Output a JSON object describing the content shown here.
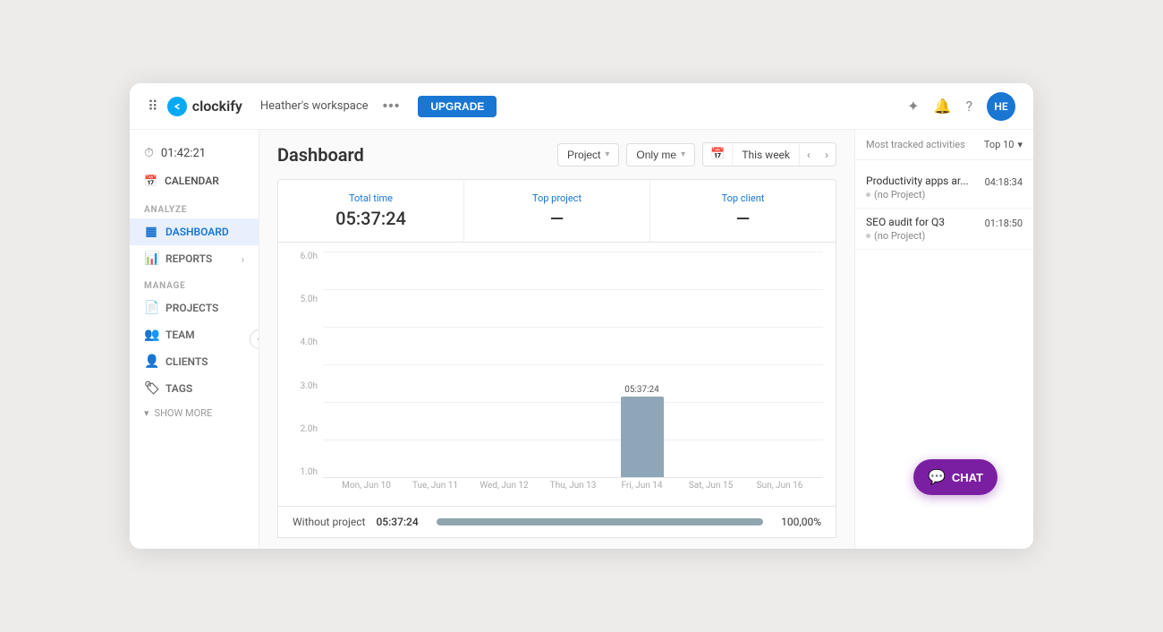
{
  "header": {
    "logo_text": "clockify",
    "logo_initials": "c",
    "workspace": "Heather's workspace",
    "more_dots": "•••",
    "upgrade_label": "UPGRADE",
    "avatar_initials": "HE"
  },
  "sidebar": {
    "timer_value": "01:42:21",
    "calendar_label": "CALENDAR",
    "analyze_label": "ANALYZE",
    "dashboard_label": "DASHBOARD",
    "reports_label": "REPORTS",
    "manage_label": "MANAGE",
    "projects_label": "PROJECTS",
    "team_label": "TEAM",
    "clients_label": "CLIENTS",
    "tags_label": "TAGS",
    "show_more_label": "SHOW MORE"
  },
  "dashboard": {
    "title": "Dashboard",
    "filter_project": "Project",
    "filter_onlyme": "Only me",
    "filter_thisweek": "This week",
    "stats": {
      "total_time_label": "Total time",
      "total_time_value": "05:37:24",
      "top_project_label": "Top project",
      "top_project_value": "—",
      "top_client_label": "Top client",
      "top_client_value": "—"
    },
    "chart": {
      "y_labels": [
        "6.0h",
        "5.0h",
        "4.0h",
        "3.0h",
        "2.0h",
        "1.0h"
      ],
      "bars": [
        {
          "day": "Mon, Jun 10",
          "time": "00:00:00",
          "height": 0
        },
        {
          "day": "Tue, Jun 11",
          "time": "00:00:00",
          "height": 0
        },
        {
          "day": "Wed, Jun 12",
          "time": "00:00:00",
          "height": 0
        },
        {
          "day": "Thu, Jun 13",
          "time": "00:00:00",
          "height": 0
        },
        {
          "day": "Fri, Jun 14",
          "time": "05:37:24",
          "height": 90,
          "active": true
        },
        {
          "day": "Sat, Jun 15",
          "time": "00:00:00",
          "height": 0
        },
        {
          "day": "Sun, Jun 16",
          "time": "00:00:00",
          "height": 0
        }
      ]
    },
    "bottom_table": {
      "label": "Without project",
      "time": "05:37:24",
      "percent": "100,00%",
      "bar_fill": 100
    }
  },
  "right_panel": {
    "title": "Most tracked activities",
    "top_selector": "Top 10",
    "items": [
      {
        "title": "Productivity apps ar...",
        "sub": "(no Project)",
        "time": "04:18:34"
      },
      {
        "title": "SEO audit for Q3",
        "sub": "(no Project)",
        "time": "01:18:50"
      }
    ]
  },
  "chat": {
    "label": "CHAT"
  }
}
